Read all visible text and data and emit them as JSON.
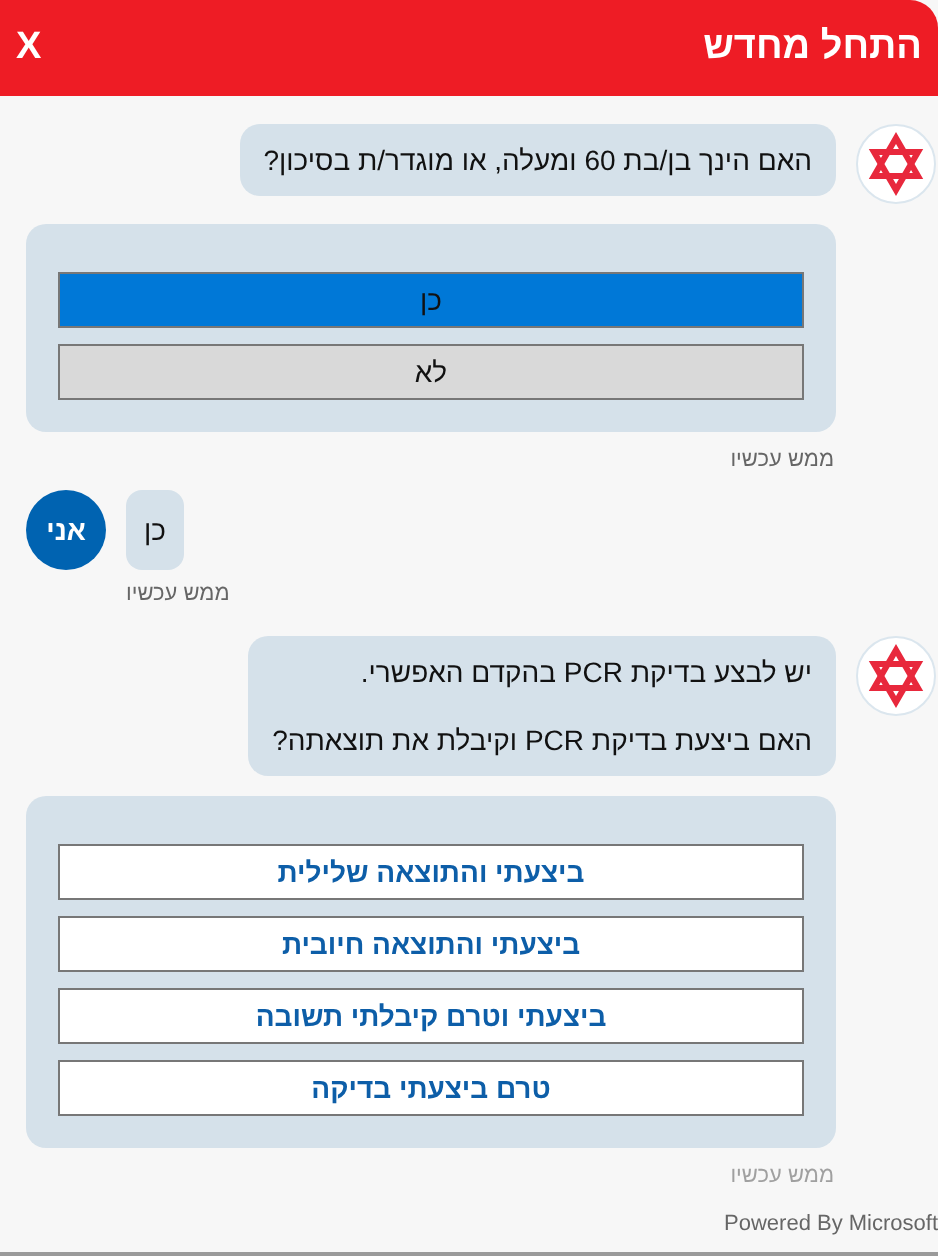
{
  "header": {
    "title": "התחל מחדש",
    "close": "X"
  },
  "messages": [
    {
      "kind": "bot_text",
      "paragraphs": [
        "האם הינך בן/בת 60 ומעלה, או מוגדר/ת בסיכון?"
      ]
    },
    {
      "kind": "bot_card",
      "answered": true,
      "options": [
        {
          "label": "כן",
          "selected": true
        },
        {
          "label": "לא",
          "selected": false
        }
      ]
    },
    {
      "kind": "bot_timestamp",
      "text": "ממש עכשיו",
      "dim": false
    },
    {
      "kind": "user_text",
      "text": "כן",
      "avatar": "אני"
    },
    {
      "kind": "user_timestamp",
      "text": "ממש עכשיו",
      "dim": false
    },
    {
      "kind": "bot_text",
      "paragraphs": [
        "יש לבצע בדיקת PCR בהקדם האפשרי.",
        "האם ביצעת בדיקת PCR וקיבלת את תוצאתה?"
      ]
    },
    {
      "kind": "bot_card",
      "answered": false,
      "options": [
        {
          "label": "ביצעתי והתוצאה שלילית",
          "selected": false
        },
        {
          "label": "ביצעתי והתוצאה חיובית",
          "selected": false
        },
        {
          "label": "ביצעתי וטרם קיבלתי תשובה",
          "selected": false
        },
        {
          "label": "טרם ביצעתי בדיקה",
          "selected": false
        }
      ]
    },
    {
      "kind": "bot_timestamp",
      "text": "ממש עכשיו",
      "dim": true
    }
  ],
  "footer": "Powered By Microsoft"
}
